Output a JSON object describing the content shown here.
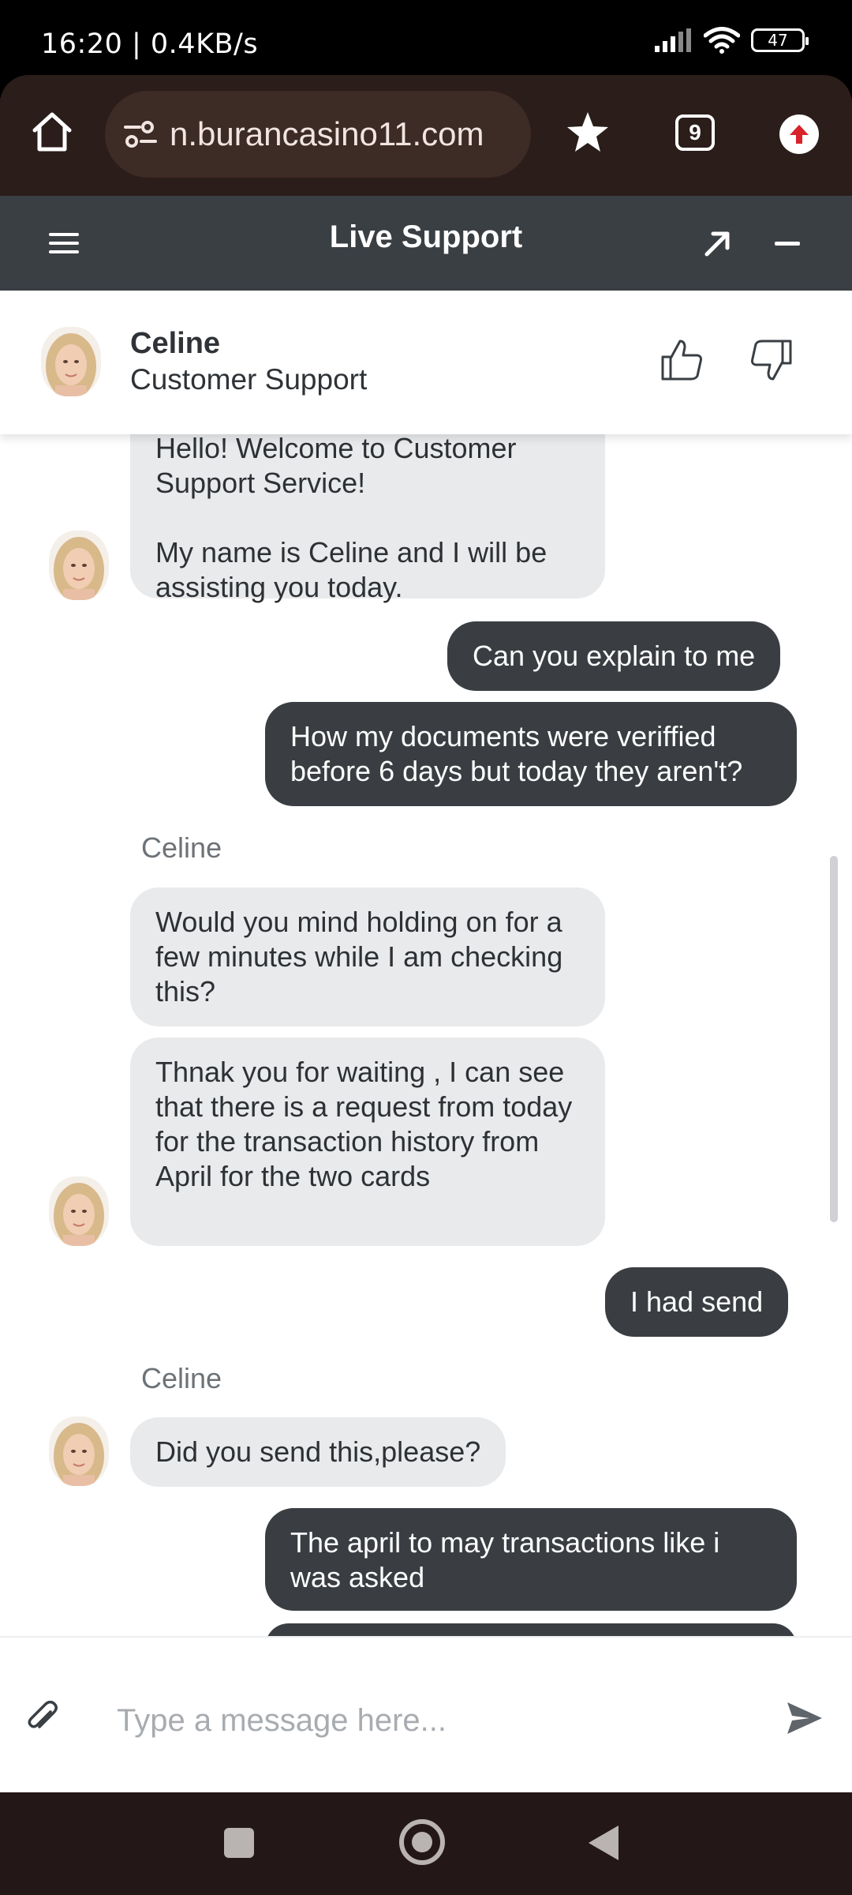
{
  "status_bar": {
    "time_speed": "16:20 | 0.4KB/s",
    "battery": "47",
    "icons": [
      "signal-icon",
      "wifi-icon",
      "battery-icon"
    ]
  },
  "browser": {
    "url": "n.burancasino11.com",
    "tab_count": "9",
    "icons": [
      "home-icon",
      "site-settings-icon",
      "star-icon",
      "tabs-icon",
      "update-icon"
    ]
  },
  "live_support": {
    "title": "Live Support",
    "icons": [
      "menu-icon",
      "expand-icon",
      "minimize-icon"
    ]
  },
  "agent": {
    "name": "Celine",
    "role": "Customer Support",
    "icons": [
      "thumbs-up-icon",
      "thumbs-down-icon"
    ]
  },
  "messages": [
    {
      "from": "agent",
      "text_partial": "Hello! Welcome to Customer",
      "text": "Support Service!"
    },
    {
      "from": "agent",
      "text": "My name is Celine and I will be assisting you today."
    },
    {
      "from": "user",
      "text": "Can you explain to me"
    },
    {
      "from": "user",
      "text": "How my documents were veriffied before 6 days but today they aren't?"
    },
    {
      "from": "agent",
      "sender": "Celine",
      "text": "Would you mind holding on for a few minutes while I am checking this?"
    },
    {
      "from": "agent",
      "text": "Thnak you for waiting , I can see that there is a request from today for the transaction history from April for the two cards"
    },
    {
      "from": "user",
      "text": "I had send"
    },
    {
      "from": "agent",
      "sender": "Celine",
      "text": "Did you send this,please?"
    },
    {
      "from": "user",
      "text": "The april to may transactions like i was asked"
    }
  ],
  "input": {
    "placeholder": "Type a message here...",
    "value": "",
    "icons": [
      "attach-icon",
      "send-icon"
    ]
  },
  "nav_bar": {
    "icons": [
      "recents-icon",
      "home-nav-icon",
      "back-icon"
    ]
  },
  "colors": {
    "header_bg": "#3a3f44",
    "agent_bubble": "#e9eaec",
    "user_bubble": "#3a3e42",
    "browser_bg": "#2a1d1a"
  }
}
